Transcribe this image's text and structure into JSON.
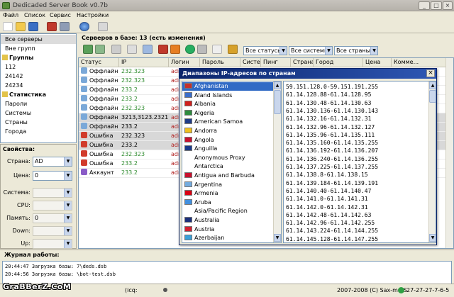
{
  "window": {
    "title": "Dedicaded Server Book v0.7b",
    "controls": [
      "_",
      "□",
      "×"
    ]
  },
  "menu": [
    "Файл",
    "Список",
    "Сервис",
    "Настройки"
  ],
  "toolbar_icons": [
    "new-icon",
    "open-icon",
    "save-icon",
    "tools-icon",
    "upload-icon",
    "globe-icon",
    "exit-icon"
  ],
  "sidebar": {
    "items": [
      {
        "label": "Все серверы",
        "kind": "item",
        "selected": true
      },
      {
        "label": "Вне групп",
        "kind": "item"
      },
      {
        "label": "Группы",
        "kind": "header"
      },
      {
        "label": "112",
        "kind": "item"
      },
      {
        "label": "24142",
        "kind": "item"
      },
      {
        "label": "24234",
        "kind": "item"
      },
      {
        "label": "Статистика",
        "kind": "header"
      },
      {
        "label": "Пароли",
        "kind": "item"
      },
      {
        "label": "Системы",
        "kind": "item"
      },
      {
        "label": "Страны",
        "kind": "item"
      },
      {
        "label": "Города",
        "kind": "item"
      }
    ]
  },
  "properties": {
    "title": "Свойства:",
    "fields": [
      {
        "label": "Страна:",
        "value": "AD",
        "enabled": true
      },
      {
        "label": "Цена:",
        "value": "0",
        "enabled": true
      },
      {
        "label": "Система:",
        "value": "",
        "enabled": false
      },
      {
        "label": "CPU:",
        "value": "",
        "enabled": false
      },
      {
        "label": "Память:",
        "value": "0",
        "enabled": false
      },
      {
        "label": "Down:",
        "value": "",
        "enabled": false
      },
      {
        "label": "Up:",
        "value": "",
        "enabled": false
      }
    ]
  },
  "main": {
    "header": "Серверов в базе: 13 (есть изменения)",
    "filters": [
      "Все статусы",
      "Все системы",
      "Все страны"
    ],
    "columns": [
      "Статус",
      "IP",
      "Логин",
      "Пароль",
      "Система",
      "Пинг",
      "Страна",
      "Город",
      "Цена",
      "Комме..."
    ],
    "rows": [
      {
        "status": "Оффлайн",
        "ip": "232.323",
        "login": "adr",
        "type": "offline",
        "ipcolor": "#2e8b2e",
        "gray": false
      },
      {
        "status": "Оффлайн",
        "ip": "232.323",
        "login": "adr",
        "type": "offline",
        "ipcolor": "#2e8b2e",
        "gray": false
      },
      {
        "status": "Оффлайн",
        "ip": "233.2",
        "login": "adr",
        "type": "offline",
        "ipcolor": "#2e8b2e",
        "gray": false
      },
      {
        "status": "Оффлайн",
        "ip": "233.2",
        "login": "adr",
        "type": "offline",
        "ipcolor": "#2e8b2e",
        "gray": false
      },
      {
        "status": "Оффлайн",
        "ip": "232.323",
        "login": "adr",
        "type": "offline",
        "ipcolor": "#2e8b2e",
        "gray": false
      },
      {
        "status": "Оффлайн",
        "ip": "3213,3123.2321",
        "login": "adr",
        "type": "offline",
        "ipcolor": "#000000",
        "gray": true
      },
      {
        "status": "Оффлайн",
        "ip": "233.2",
        "login": "adr",
        "type": "offline",
        "ipcolor": "#000000",
        "gray": true
      },
      {
        "status": "Ошибка",
        "ip": "232.323",
        "login": "adr",
        "type": "error",
        "ipcolor": "#000000",
        "gray": true
      },
      {
        "status": "Ошибка",
        "ip": "233.2",
        "login": "adr",
        "type": "error",
        "ipcolor": "#000000",
        "gray": true
      },
      {
        "status": "Ошибка",
        "ip": "232.323",
        "login": "adr",
        "type": "error",
        "ipcolor": "#2e8b2e",
        "gray": false
      },
      {
        "status": "Ошибка",
        "ip": "233.2",
        "login": "adr",
        "type": "error",
        "ipcolor": "#2e8b2e",
        "gray": false
      },
      {
        "status": "Аккаунт",
        "ip": "233.2",
        "login": "adr",
        "type": "account",
        "ipcolor": "#2e8b2e",
        "gray": false
      }
    ]
  },
  "dialog": {
    "title": "Диапазоны IP-адресов по странам",
    "close": "×",
    "countries": [
      {
        "name": "Afghanistan",
        "flag": "#c4302b",
        "selected": true
      },
      {
        "name": "Aland Islands",
        "flag": "#3b6fc9"
      },
      {
        "name": "Albania",
        "flag": "#d0201d"
      },
      {
        "name": "Algeria",
        "flag": "#2e8b3e"
      },
      {
        "name": "American Samoa",
        "flag": "#1f3c88"
      },
      {
        "name": "Andorra",
        "flag": "#f0c020"
      },
      {
        "name": "Angola",
        "flag": "#c8102e"
      },
      {
        "name": "Anguilla",
        "flag": "#1a3a8a"
      },
      {
        "name": "Anonymous Proxy",
        "flag": ""
      },
      {
        "name": "Antarctica",
        "flag": ""
      },
      {
        "name": "Antigua and Barbuda",
        "flag": "#c8102e"
      },
      {
        "name": "Argentina",
        "flag": "#74acdf"
      },
      {
        "name": "Armenia",
        "flag": "#d90012"
      },
      {
        "name": "Aruba",
        "flag": "#418fde"
      },
      {
        "name": "Asia/Pacific Region",
        "flag": ""
      },
      {
        "name": "Australia",
        "flag": "#1a2f7a"
      },
      {
        "name": "Austria",
        "flag": "#d22030"
      },
      {
        "name": "Azerbaijan",
        "flag": "#3aa0d8"
      }
    ],
    "ranges": [
      "59.151.128.0-59.151.191.255",
      "61.14.128.88-61.14.128.95",
      "61.14.130.48-61.14.130.63",
      "61.14.130.136-61.14.130.143",
      "61.14.132.16-61.14.132.31",
      "61.14.132.96-61.14.132.127",
      "61.14.135.96-61.14.135.111",
      "61.14.135.160-61.14.135.255",
      "61.14.136.192-61.14.136.207",
      "61.14.136.240-61.14.136.255",
      "61.14.137.225-61.14.137.255",
      "61.14.138.8-61.14.138.15",
      "61.14.139.184-61.14.139.191",
      "61.14.140.40-61.14.140.47",
      "61.14.141.0-61.14.141.31",
      "61.14.142.0-61.14.142.31",
      "61.14.142.48-61.14.142.63",
      "61.14.142.96-61.14.142.255",
      "61.14.143.224-61.14.144.255",
      "61.14.145.128-61.14.147.255"
    ]
  },
  "log": {
    "title": "Журнал работы:",
    "lines": [
      "20:44:47  Загрузка базы:           7\\deds.dsb",
      "20:44:56  Загрузка базы:           \\bot-test.dsb"
    ]
  },
  "statusbar": {
    "watermark": "GraBBerZ.CoM",
    "icq": "(icq:",
    "copyright": "2007-2008 (C) Sax-mmS",
    "icq_number": "27-27-27-7-6-5"
  },
  "colors": {
    "selection": "#316ac5",
    "dialog_title": "#0a246a",
    "ip_green": "#2e8b2e",
    "border": "#7f9db9"
  }
}
